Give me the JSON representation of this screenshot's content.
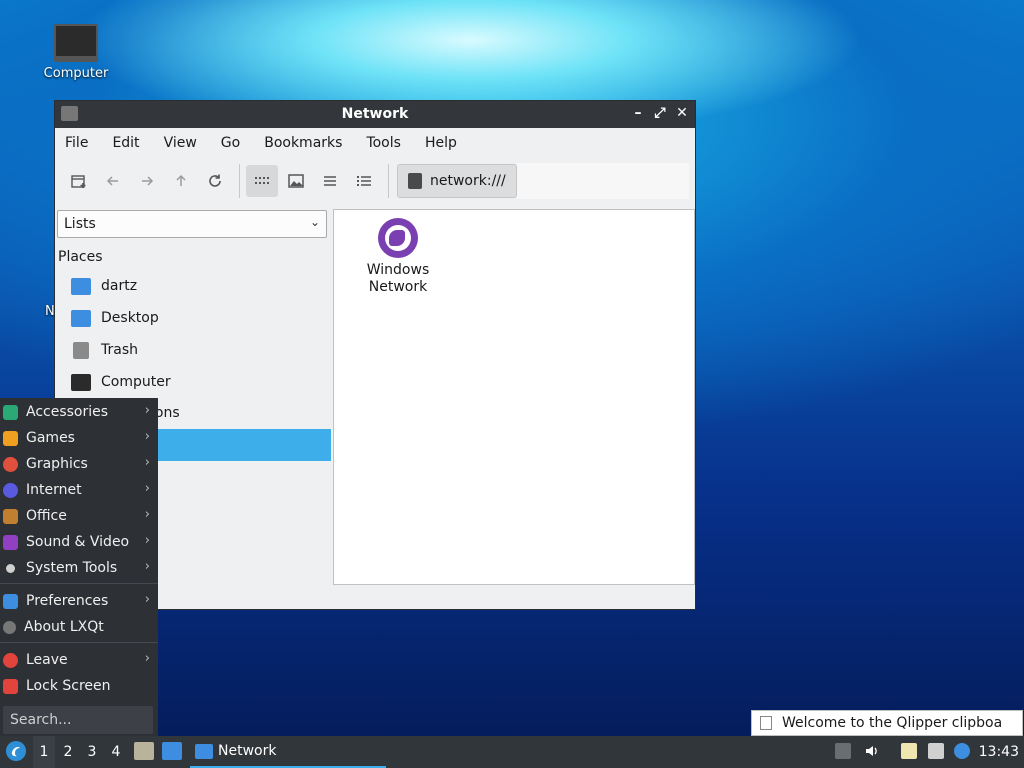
{
  "desktop": {
    "computer_label": "Computer",
    "partial_label": "N"
  },
  "window": {
    "title": "Network",
    "icon": "folder-icon",
    "controls": {
      "minimize": "–",
      "maximize": "⤢",
      "close": "✕"
    },
    "menubar": [
      "File",
      "Edit",
      "View",
      "Go",
      "Bookmarks",
      "Tools",
      "Help"
    ],
    "toolbar": {
      "location": "network:///"
    },
    "side_combo": "Lists",
    "places_header": "Places",
    "places": [
      {
        "label": "dartz",
        "icon": "home-folder-icon",
        "color": "#3d8ee0"
      },
      {
        "label": "Desktop",
        "icon": "desktop-icon",
        "color": "#3d8ee0"
      },
      {
        "label": "Trash",
        "icon": "trash-icon",
        "color": "#8a8a8a"
      },
      {
        "label": "Computer",
        "icon": "computer-icon",
        "color": "#2b2b2b"
      }
    ],
    "devices_partial": "ions",
    "items": [
      {
        "label": "Windows Network",
        "icon": "network-globe-icon"
      }
    ]
  },
  "start_menu": {
    "items": [
      {
        "label": "Accessories",
        "icon": "accessories-icon",
        "color": "#2aa876",
        "submenu": true
      },
      {
        "label": "Games",
        "icon": "games-icon",
        "color": "#f0a020",
        "submenu": true
      },
      {
        "label": "Graphics",
        "icon": "graphics-icon",
        "color": "#e0503c",
        "submenu": true
      },
      {
        "label": "Internet",
        "icon": "internet-icon",
        "color": "#5a5ae0",
        "submenu": true
      },
      {
        "label": "Office",
        "icon": "office-icon",
        "color": "#c08030",
        "submenu": true
      },
      {
        "label": "Sound & Video",
        "icon": "sound-video-icon",
        "color": "#9040c0",
        "submenu": true
      },
      {
        "label": "System Tools",
        "icon": "system-tools-icon",
        "color": "#d0d0d0",
        "submenu": true
      }
    ],
    "settings": [
      {
        "label": "Preferences",
        "icon": "preferences-icon",
        "color": "#3d8ee0",
        "submenu": true
      },
      {
        "label": "About LXQt",
        "icon": "info-icon",
        "color": "#777777",
        "submenu": false
      }
    ],
    "session": [
      {
        "label": "Leave",
        "icon": "power-icon",
        "color": "#e0443c",
        "submenu": true
      },
      {
        "label": "Lock Screen",
        "icon": "lock-icon",
        "color": "#e0443c",
        "submenu": false
      }
    ],
    "search_placeholder": "Search..."
  },
  "taskbar": {
    "workspaces": [
      "1",
      "2",
      "3",
      "4"
    ],
    "current_workspace": "1",
    "task_label": "Network",
    "clock": "13:43"
  },
  "notification": {
    "text": "Welcome to the Qlipper clipboa"
  }
}
